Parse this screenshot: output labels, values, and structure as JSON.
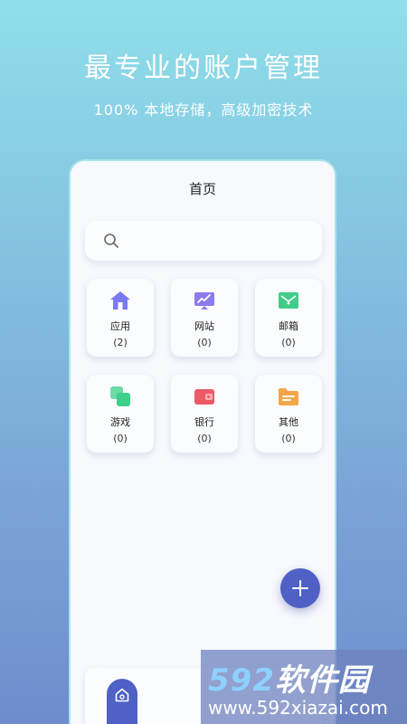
{
  "promo": {
    "headline": "最专业的账户管理",
    "subline": "100% 本地存储，高级加密技术"
  },
  "app": {
    "page_title": "首页",
    "search": {
      "placeholder": "",
      "value": ""
    },
    "categories": [
      {
        "label": "应用",
        "count": "(2)",
        "icon": "house-icon",
        "color": "#7b79f0"
      },
      {
        "label": "网站",
        "count": "(0)",
        "icon": "monitor-chart-icon",
        "color": "#8a7cf0"
      },
      {
        "label": "邮箱",
        "count": "(0)",
        "icon": "envelope-icon",
        "color": "#42cc8c"
      },
      {
        "label": "游戏",
        "count": "(0)",
        "icon": "layers-icon",
        "color": "#3ecf8a"
      },
      {
        "label": "银行",
        "count": "(0)",
        "icon": "wallet-icon",
        "color": "#ec5a66"
      },
      {
        "label": "其他",
        "count": "(0)",
        "icon": "folder-icon",
        "color": "#f3a64a"
      }
    ],
    "fab_icon": "plus-icon",
    "nav_home_icon": "home-nav-icon",
    "accent": "#4f61c5"
  },
  "watermark": {
    "logo_number": "592",
    "logo_text": "软件园",
    "url": "www.592xiazai.com"
  }
}
